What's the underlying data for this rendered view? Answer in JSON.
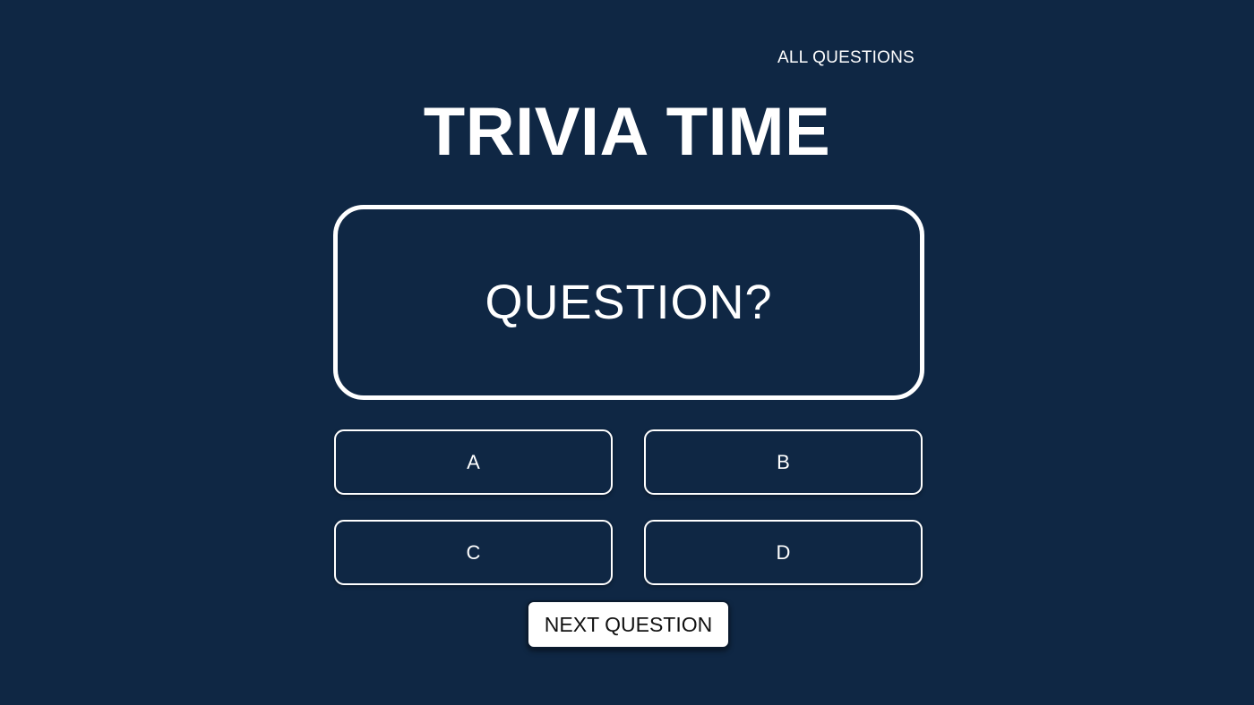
{
  "header": {
    "all_questions_link": "ALL QUESTIONS"
  },
  "title": "TRIVIA TIME",
  "question": {
    "text": "QUESTION?"
  },
  "answers": [
    {
      "label": "A"
    },
    {
      "label": "B"
    },
    {
      "label": "C"
    },
    {
      "label": "D"
    }
  ],
  "controls": {
    "next_label": "NEXT QUESTION"
  },
  "colors": {
    "background": "#0f2744",
    "foreground": "#ffffff",
    "button_text": "#111111"
  }
}
